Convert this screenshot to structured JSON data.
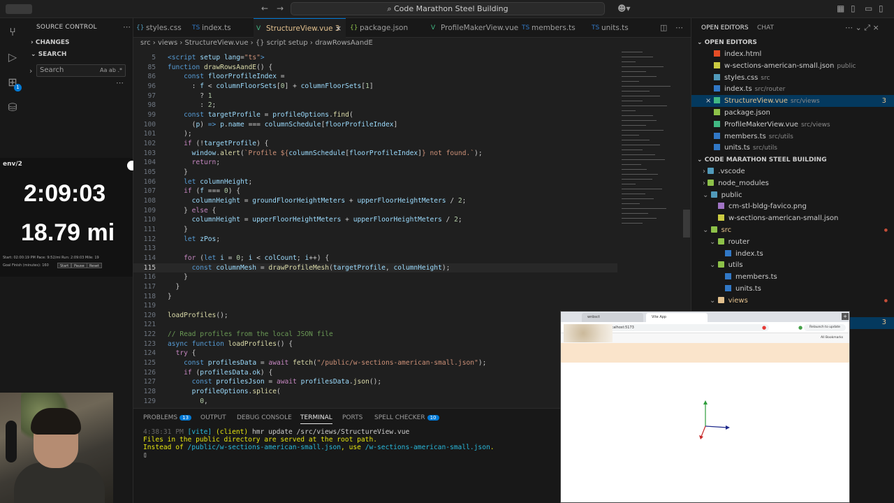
{
  "window": {
    "title": "Code Marathon Steel Building"
  },
  "activity_bar": {
    "source_control_badge": "1"
  },
  "left_sidebar": {
    "header": "SOURCE CONTROL",
    "changes_label": "CHANGES",
    "search_label": "SEARCH",
    "search_placeholder": "Search",
    "search_options": "Aa  ab  .*"
  },
  "overlay": {
    "env_label": "env/2",
    "timer": "2:09:03",
    "distance": "18.79 mi",
    "stats_line": "Start: 02:00:19 PM   Pace: 9:52/mi   Run: 2:09:03   Mile: 19",
    "goal_label": "Goal Finish (minutes):",
    "goal_value": "160",
    "start_button": "Start",
    "pause_button": "Pause",
    "reset_button": "Reset"
  },
  "tabs": [
    {
      "label": "styles.css",
      "icon": "{}"
    },
    {
      "label": "index.ts",
      "icon": "TS"
    },
    {
      "label": "StructureView.vue 3",
      "icon": "V",
      "active": true
    },
    {
      "label": "package.json",
      "icon": "{}"
    },
    {
      "label": "ProfileMakerView.vue",
      "icon": "V"
    },
    {
      "label": "members.ts",
      "icon": "TS"
    },
    {
      "label": "units.ts",
      "icon": "TS"
    }
  ],
  "breadcrumb": "src  ›  views  ›  StructureView.vue  ›  {} script setup  ›  drawRowsAandE",
  "code_lines": [
    {
      "n": "5",
      "html": "<span class=\"k\">&lt;script</span> <span class=\"v\">setup</span> <span class=\"v\">lang</span>=<span class=\"s\">\"ts\"</span><span class=\"k\">&gt;</span>"
    },
    {
      "n": "85",
      "html": "<span class=\"k\">function</span> <span class=\"f\">drawRowsAandE</span>() {"
    },
    {
      "n": "86",
      "html": "    <span class=\"k\">const</span> <span class=\"v\">floorProfileIndex</span> ="
    },
    {
      "n": "96",
      "html": "      : <span class=\"v\">f</span> &lt; <span class=\"v\">columnFloorSets</span>[<span class=\"n\">0</span>] + <span class=\"v\">columnFloorSets</span>[<span class=\"n\">1</span>]"
    },
    {
      "n": "97",
      "html": "        ? <span class=\"n\">1</span>"
    },
    {
      "n": "98",
      "html": "        : <span class=\"n\">2</span>;"
    },
    {
      "n": "99",
      "html": "    <span class=\"k\">const</span> <span class=\"v\">targetProfile</span> = <span class=\"v\">profileOptions</span>.<span class=\"f\">find</span>("
    },
    {
      "n": "100",
      "html": "      (<span class=\"v\">p</span>) <span class=\"k\">=&gt;</span> <span class=\"v\">p</span>.<span class=\"v\">name</span> === <span class=\"v\">columnSchedule</span>[<span class=\"v\">floorProfileIndex</span>]"
    },
    {
      "n": "101",
      "html": "    );"
    },
    {
      "n": "102",
      "html": "    <span class=\"kc\">if</span> (!<span class=\"v\">targetProfile</span>) {"
    },
    {
      "n": "103",
      "html": "      <span class=\"v\">window</span>.<span class=\"f\">alert</span>(<span class=\"s\">`Profile ${</span><span class=\"v\">columnSchedule</span>[<span class=\"v\">floorProfileIndex</span>]<span class=\"s\">} not found.`</span>);"
    },
    {
      "n": "104",
      "html": "      <span class=\"kc\">return</span>;"
    },
    {
      "n": "105",
      "html": "    }"
    },
    {
      "n": "106",
      "html": "    <span class=\"k\">let</span> <span class=\"v\">columnHeight</span>;"
    },
    {
      "n": "107",
      "html": "    <span class=\"kc\">if</span> (<span class=\"v\">f</span> === <span class=\"n\">0</span>) {"
    },
    {
      "n": "108",
      "html": "      <span class=\"v\">columnHeight</span> = <span class=\"v\">groundFloorHeightMeters</span> + <span class=\"v\">upperFloorHeightMeters</span> / <span class=\"n\">2</span>;"
    },
    {
      "n": "109",
      "html": "    } <span class=\"kc\">else</span> {"
    },
    {
      "n": "110",
      "html": "      <span class=\"v\">columnHeight</span> = <span class=\"v\">upperFloorHeightMeters</span> + <span class=\"v\">upperFloorHeightMeters</span> / <span class=\"n\">2</span>;"
    },
    {
      "n": "111",
      "html": "    }"
    },
    {
      "n": "112",
      "html": "    <span class=\"k\">let</span> <span class=\"v\">zPos</span>;"
    },
    {
      "n": "113",
      "html": ""
    },
    {
      "n": "114",
      "html": "    <span class=\"kc\">for</span> (<span class=\"k\">let</span> <span class=\"v\">i</span> = <span class=\"n\">0</span>; <span class=\"v\">i</span> &lt; <span class=\"v\">colCount</span>; <span class=\"v\">i</span>++) {"
    },
    {
      "n": "115",
      "html": "      <span class=\"k\">const</span> <span class=\"v\">columnMesh</span> = <span class=\"f\">drawProfileMesh</span>(<span class=\"v\">targetProfile</span>, <span class=\"v\">columnHeight</span>);",
      "current": true
    },
    {
      "n": "116",
      "html": "    }"
    },
    {
      "n": "117",
      "html": "  }"
    },
    {
      "n": "118",
      "html": "}"
    },
    {
      "n": "119",
      "html": ""
    },
    {
      "n": "120",
      "html": "<span class=\"f\">loadProfiles</span>();"
    },
    {
      "n": "121",
      "html": ""
    },
    {
      "n": "122",
      "html": "<span class=\"c\">// Read profiles from the local JSON file</span>"
    },
    {
      "n": "123",
      "html": "<span class=\"k\">async</span> <span class=\"k\">function</span> <span class=\"f\">loadProfiles</span>() {"
    },
    {
      "n": "124",
      "html": "  <span class=\"kc\">try</span> {"
    },
    {
      "n": "125",
      "html": "    <span class=\"k\">const</span> <span class=\"v\">profilesData</span> = <span class=\"kc\">await</span> <span class=\"f\">fetch</span>(<span class=\"s\">\"/public/w-sections-american-small.json\"</span>);"
    },
    {
      "n": "126",
      "html": "    <span class=\"kc\">if</span> (<span class=\"v\">profilesData</span>.<span class=\"v\">ok</span>) {"
    },
    {
      "n": "127",
      "html": "      <span class=\"k\">const</span> <span class=\"v\">profilesJson</span> = <span class=\"kc\">await</span> <span class=\"v\">profilesData</span>.<span class=\"f\">json</span>();"
    },
    {
      "n": "128",
      "html": "      <span class=\"v\">profileOptions</span>.<span class=\"f\">splice</span>("
    },
    {
      "n": "129",
      "html": "        <span class=\"n\">0</span>,"
    }
  ],
  "panel": {
    "tabs": [
      {
        "label": "PROBLEMS",
        "badge": "13"
      },
      {
        "label": "OUTPUT",
        "badge": ""
      },
      {
        "label": "DEBUG CONSOLE",
        "badge": ""
      },
      {
        "label": "TERMINAL",
        "badge": "",
        "active": true
      },
      {
        "label": "PORTS",
        "badge": ""
      },
      {
        "label": "SPELL CHECKER",
        "badge": "10"
      }
    ],
    "terminal_line1_time": "4:38:31 PM",
    "terminal_line1_tag": "[vite]",
    "terminal_line1_client": "(client)",
    "terminal_line1_msg": "hmr update /src/views/StructureView.vue",
    "terminal_line2": "Files in the public directory are served at the root path.",
    "terminal_line3_a": "Instead of ",
    "terminal_line3_b": "/public/w-sections-american-small.json",
    "terminal_line3_c": ", use ",
    "terminal_line3_d": "/w-sections-american-small.json",
    "terminal_line3_e": "."
  },
  "right_sidebar": {
    "tab_open_editors": "OPEN EDITORS",
    "tab_chat": "CHAT",
    "open_editors_label": "OPEN EDITORS",
    "open_editors": [
      {
        "name": "index.html",
        "desc": "",
        "color": "#e44d26"
      },
      {
        "name": "w-sections-american-small.json",
        "desc": "public",
        "color": "#cbcb41"
      },
      {
        "name": "styles.css",
        "desc": "src",
        "color": "#519aba"
      },
      {
        "name": "index.ts",
        "desc": "src/router",
        "color": "#3178c6"
      },
      {
        "name": "StructureView.vue",
        "desc": "src/views",
        "color": "#41b883",
        "modified": true,
        "count": "3"
      },
      {
        "name": "package.json",
        "desc": "",
        "color": "#8dc149"
      },
      {
        "name": "ProfileMakerView.vue",
        "desc": "src/views",
        "color": "#41b883"
      },
      {
        "name": "members.ts",
        "desc": "src/utils",
        "color": "#3178c6"
      },
      {
        "name": "units.ts",
        "desc": "src/utils",
        "color": "#3178c6"
      }
    ],
    "project_label": "CODE MARATHON STEEL BUILDING",
    "tree": [
      {
        "name": ".vscode",
        "depth": 1,
        "folder": true,
        "color": "#519aba"
      },
      {
        "name": "node_modules",
        "depth": 1,
        "folder": true,
        "color": "#8dc149"
      },
      {
        "name": "public",
        "depth": 1,
        "folder": true,
        "open": true,
        "color": "#519aba"
      },
      {
        "name": "cm-stl-bldg-favico.png",
        "depth": 2,
        "color": "#a074c4"
      },
      {
        "name": "w-sections-american-small.json",
        "depth": 2,
        "color": "#cbcb41"
      },
      {
        "name": "src",
        "depth": 1,
        "folder": true,
        "open": true,
        "color": "#8dc149",
        "modified": true
      },
      {
        "name": "router",
        "depth": 2,
        "folder": true,
        "open": true,
        "color": "#8dc149"
      },
      {
        "name": "index.ts",
        "depth": 3,
        "color": "#3178c6"
      },
      {
        "name": "utils",
        "depth": 2,
        "folder": true,
        "open": true,
        "color": "#8dc149"
      },
      {
        "name": "members.ts",
        "depth": 3,
        "color": "#3178c6"
      },
      {
        "name": "units.ts",
        "depth": 3,
        "color": "#3178c6"
      },
      {
        "name": "views",
        "depth": 2,
        "folder": true,
        "open": true,
        "color": "#e2c08d",
        "modified": true
      }
    ],
    "tree_count": "3"
  },
  "browser": {
    "tab1": "wnbsct",
    "tab2": "Vite App",
    "url": "localhost:5173",
    "relaunch": "Relaunch to update",
    "bookmarks": "All Bookmarks"
  },
  "colors": {
    "accent": "#0078d4",
    "editor_bg": "#1f1f1f",
    "sidebar_bg": "#181818"
  }
}
